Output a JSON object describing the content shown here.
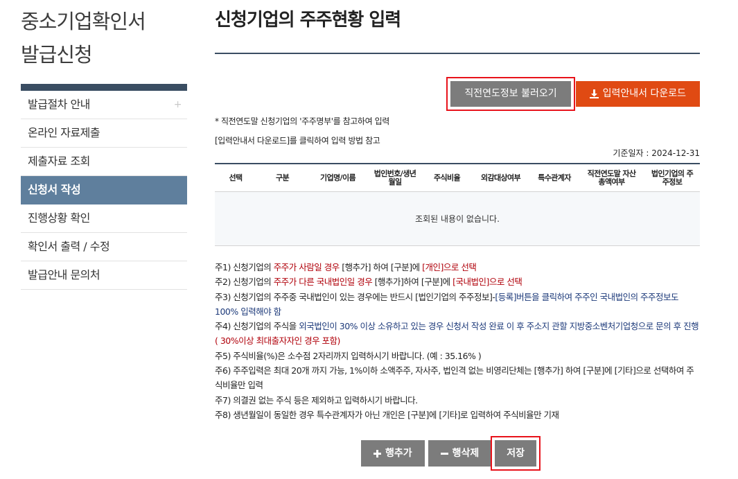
{
  "sidebar": {
    "title_line1": "중소기업확인서",
    "title_line2": "발급신청",
    "items": [
      {
        "label": "발급절차 안내",
        "plus": "+"
      },
      {
        "label": "온라인 자료제출"
      },
      {
        "label": "제출자료 조회"
      },
      {
        "label": "신청서 작성"
      },
      {
        "label": "진행상황 확인"
      },
      {
        "label": "확인서 출력 / 수정"
      },
      {
        "label": "발급안내 문의처"
      }
    ]
  },
  "main": {
    "title": "신청기업의 주주현황 입력",
    "load_prev_button": "직전연도정보 불러오기",
    "download_button": "입력안내서 다운로드",
    "note1": "* 직전연도말 신청기업의 '주주명부'를 참고하여 입력",
    "note2": "[입력안내서 다운로드]를 클릭하여 입력 방법 참고",
    "base_date": "기준일자 : 2024-12-31",
    "table": {
      "headers": [
        "선택",
        "구분",
        "기업명/이름",
        "법인번호/생년월일",
        "주식비율",
        "외감대상여부",
        "특수관계자",
        "직전연도말 자산총액여부",
        "법인기업의 주주정보"
      ],
      "empty_message": "조회된 내용이 없습니다."
    },
    "notes": {
      "n1a": "주1) 신청기업의 ",
      "n1b": "주주가 사람일 경우",
      "n1c": " [행추가] 하여 [구분]에 ",
      "n1d": "[개인]으로 선택",
      "n2a": "주2) 신청기업의 ",
      "n2b": "주주가 다른 국내법인일 경우",
      "n2c": " [행추가]하여 [구분]에 ",
      "n2d": "[국내법인]으로 선택",
      "n3a": "주3) 신청기업의 주주중 국내법인이 있는 경우에는 반드시 [법인기업의 주주정보]-",
      "n3b": "[등록]버튼을 클릭하여 주주인 국내법인의 주주정보도 100% 입력해야 함",
      "n4a": "주4) 신청기업의 주식을 ",
      "n4b": "외국법인이 30% 이상 소유하고 있는 경우 신청서 작성 완료 이 후 주소지 관할 지방중소벤처기업청으로 문의 후 진행",
      "n4c": "( 30%이상 최대출자자인 경우 포함)",
      "n5": "주5) 주식비율(%)은 소수점 2자리까지 입력하시기 바랍니다. (예 : 35.16% )",
      "n6": "주6) 주주입력은 최대 20개 까지 가능, 1%이하 소액주주, 자사주, 법인격 없는 비영리단체는 [행추가] 하여 [구분]에 [기타]으로 선택하여 주식비율만 입력",
      "n7": "주7) 의결권 없는 주식 등은 제외하고 입력하시기 바랍니다.",
      "n8": "주8) 생년월일이 동일한 경우 특수관계자가 아닌 개인은 [구분]에 [기타]로 입력하여 주식비율만 기재"
    },
    "add_row_button": "행추가",
    "delete_row_button": "행삭제",
    "save_button": "저장"
  },
  "colors": {
    "accent_navy": "#3a4d62",
    "active_menu": "#5f7f9d",
    "download_orange": "#e04a13",
    "highlight_red": "#e8121a"
  }
}
